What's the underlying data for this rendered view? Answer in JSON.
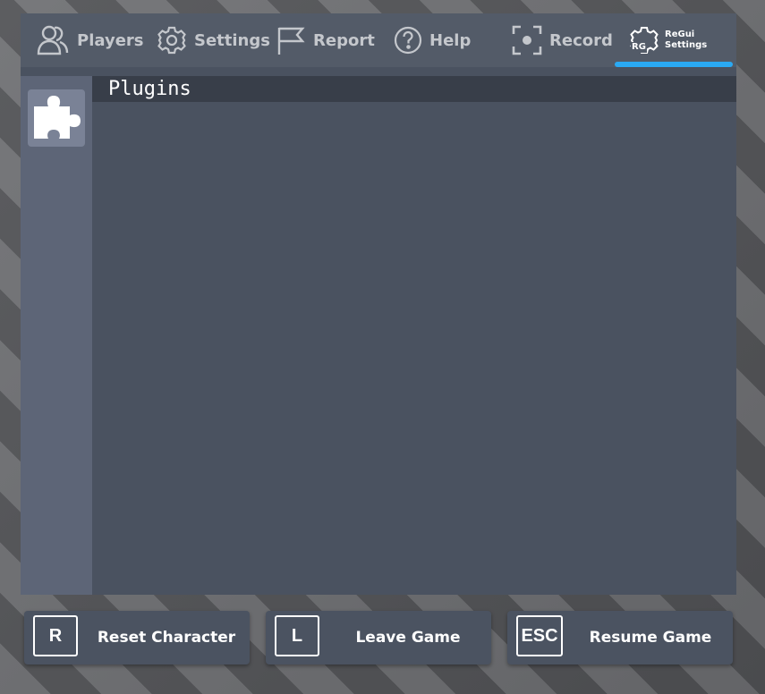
{
  "topbar": {
    "tabs": [
      {
        "label": "Players",
        "icon": "players-icon"
      },
      {
        "label": "Settings",
        "icon": "gear-icon"
      },
      {
        "label": "Report",
        "icon": "flag-icon"
      },
      {
        "label": "Help",
        "icon": "help-icon"
      },
      {
        "label": "Record",
        "icon": "record-icon"
      }
    ],
    "regui": {
      "badge": "RG",
      "line1": "ReGui",
      "line2": "Settings",
      "icon": "regui-gear-icon"
    },
    "active_tab": "ReGui Settings",
    "accent_color": "#2aa9f3"
  },
  "sidebar": {
    "items": [
      {
        "icon": "puzzle-piece-icon"
      }
    ]
  },
  "content": {
    "title": "Plugins"
  },
  "bottom": {
    "buttons": [
      {
        "key": "R",
        "label": "Reset Character"
      },
      {
        "key": "L",
        "label": "Leave Game"
      },
      {
        "key": "ESC",
        "label": "Resume Game"
      }
    ]
  }
}
